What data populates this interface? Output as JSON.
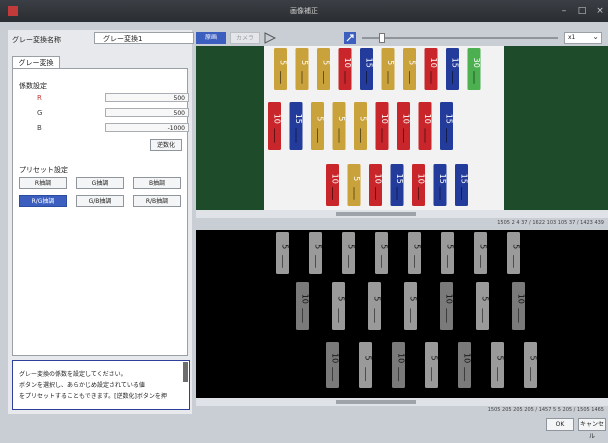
{
  "window": {
    "title": "画像補正",
    "min": "–",
    "max": "□",
    "close": "×"
  },
  "conversion": {
    "name_label": "グレー変換名称",
    "name_value": "グレー変換1"
  },
  "tab": {
    "label": "グレー変換"
  },
  "coefficients": {
    "heading": "係数設定",
    "items": [
      {
        "label": "R",
        "value": "500"
      },
      {
        "label": "G",
        "value": "500"
      },
      {
        "label": "B",
        "value": "-1000"
      }
    ],
    "apply_label": "逆数化"
  },
  "presets": {
    "heading": "プリセット設定",
    "buttons": [
      "R抽調",
      "G抽調",
      "B抽調",
      "R/G抽調",
      "G/B抽調",
      "R/B抽調"
    ],
    "selected_index": 3
  },
  "help": {
    "lines": [
      "グレー変換の係数を設定してください。",
      "ボタンを選択し、あらかじめ設定されている値",
      "をプリセットすることもできます。[逆数化]ボタンを押",
      "すと、係数の符号が反転します。"
    ]
  },
  "toolbar": {
    "original_label": "原画",
    "camera_label": "カメラ",
    "play_icon": "play-icon",
    "fit_icon": "fit-icon",
    "zoom_value": "x1",
    "zoom_slider_fraction": 0.1
  },
  "fuse_top": {
    "row1": [
      {
        "label": "5",
        "color": "#caa23c"
      },
      {
        "label": "5",
        "color": "#caa23c"
      },
      {
        "label": "5",
        "color": "#caa23c"
      },
      {
        "label": "10",
        "color": "#c9262b"
      },
      {
        "label": "15",
        "color": "#233b9a"
      },
      {
        "label": "5",
        "color": "#caa23c"
      },
      {
        "label": "5",
        "color": "#caa23c"
      },
      {
        "label": "10",
        "color": "#c9262b"
      },
      {
        "label": "15",
        "color": "#233b9a"
      },
      {
        "label": "30",
        "color": "#4caf50"
      }
    ],
    "row2": [
      {
        "label": "10",
        "color": "#c9262b"
      },
      {
        "label": "15",
        "color": "#233b9a"
      },
      {
        "label": "5",
        "color": "#caa23c"
      },
      {
        "label": "5",
        "color": "#caa23c"
      },
      {
        "label": "5",
        "color": "#caa23c"
      },
      {
        "label": "10",
        "color": "#c9262b"
      },
      {
        "label": "10",
        "color": "#c9262b"
      },
      {
        "label": "10",
        "color": "#c9262b"
      },
      {
        "label": "15",
        "color": "#233b9a"
      }
    ],
    "row3": [
      {
        "label": "10",
        "color": "#c9262b"
      },
      {
        "label": "5",
        "color": "#caa23c"
      },
      {
        "label": "10",
        "color": "#c9262b"
      },
      {
        "label": "15",
        "color": "#233b9a"
      },
      {
        "label": "10",
        "color": "#c9262b"
      },
      {
        "label": "15",
        "color": "#233b9a"
      },
      {
        "label": "15",
        "color": "#233b9a"
      }
    ]
  },
  "fuse_bottom": {
    "row1": [
      {
        "label": "5",
        "shade": "#9a9a9a"
      },
      {
        "label": "5",
        "shade": "#9a9a9a"
      },
      {
        "label": "5",
        "shade": "#9a9a9a"
      },
      {
        "label": "5",
        "shade": "#9a9a9a"
      },
      {
        "label": "5",
        "shade": "#9a9a9a"
      },
      {
        "label": "5",
        "shade": "#9a9a9a"
      },
      {
        "label": "5",
        "shade": "#9a9a9a"
      },
      {
        "label": "5",
        "shade": "#9a9a9a"
      }
    ],
    "row2": [
      {
        "label": "10",
        "shade": "#7a7a7a"
      },
      {
        "label": "5",
        "shade": "#9a9a9a"
      },
      {
        "label": "5",
        "shade": "#9a9a9a"
      },
      {
        "label": "5",
        "shade": "#9a9a9a"
      },
      {
        "label": "10",
        "shade": "#7a7a7a"
      },
      {
        "label": "5",
        "shade": "#9a9a9a"
      },
      {
        "label": "10",
        "shade": "#7a7a7a"
      }
    ],
    "row3": [
      {
        "label": "10",
        "shade": "#7a7a7a"
      },
      {
        "label": "5",
        "shade": "#9a9a9a"
      },
      {
        "label": "10",
        "shade": "#7a7a7a"
      },
      {
        "label": "5",
        "shade": "#9a9a9a"
      },
      {
        "label": "10",
        "shade": "#7a7a7a"
      },
      {
        "label": "5",
        "shade": "#9a9a9a"
      },
      {
        "label": "5",
        "shade": "#9a9a9a"
      }
    ]
  },
  "status_top": "1505  2  4  37 / 1622  103  105  37 / 1423  439",
  "status_bottom": "1505  205  205  205 / 1457  5  5  205 / 1505  1465",
  "buttons": {
    "ok": "OK",
    "cancel": "キャンセル"
  }
}
